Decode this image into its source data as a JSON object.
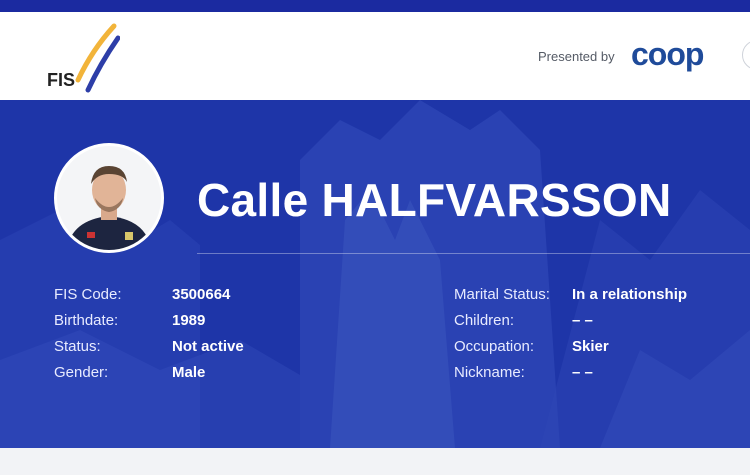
{
  "header": {
    "logo_text": "FIS",
    "presented_by": "Presented by",
    "sponsor_logo_text": "coop"
  },
  "athlete": {
    "name": "Calle HALFVARSSON",
    "photo": "athlete-portrait"
  },
  "details_left": [
    {
      "label": "FIS Code:",
      "value": "3500664"
    },
    {
      "label": "Birthdate:",
      "value": "1989"
    },
    {
      "label": "Status:",
      "value": "Not active"
    },
    {
      "label": "Gender:",
      "value": "Male"
    }
  ],
  "details_right": [
    {
      "label": "Marital Status:",
      "value": "In a relationship"
    },
    {
      "label": "Children:",
      "value": "– –"
    },
    {
      "label": "Occupation:",
      "value": "Skier"
    },
    {
      "label": "Nickname:",
      "value": "– –"
    }
  ],
  "colors": {
    "brand_blue": "#1e35a8",
    "top_strip": "#1b2aa0",
    "coop_blue": "#1f4b9a",
    "fis_yellow": "#f2b43a"
  }
}
